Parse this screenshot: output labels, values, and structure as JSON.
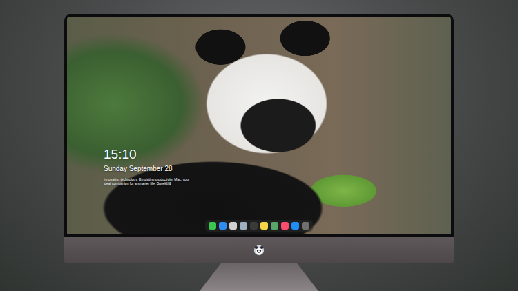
{
  "clock": {
    "time": "15:10",
    "date": "Sunday September 28",
    "tagline": "Innovating technology, Emulating productivity, Mac, your ideal companion for a smarter life. Base端版"
  },
  "dock": {
    "apps": [
      {
        "color": "#3bc651"
      },
      {
        "color": "#2f8cf0"
      },
      {
        "color": "#d0d0d0"
      },
      {
        "color": "#9fb0c2"
      },
      {
        "color": "#3a3a3a"
      },
      {
        "color": "#f5d547"
      },
      {
        "color": "#5aa56a"
      },
      {
        "color": "#fa4d6e"
      },
      {
        "color": "#1f8ff5"
      },
      {
        "color": "#6f6f6f"
      }
    ]
  }
}
